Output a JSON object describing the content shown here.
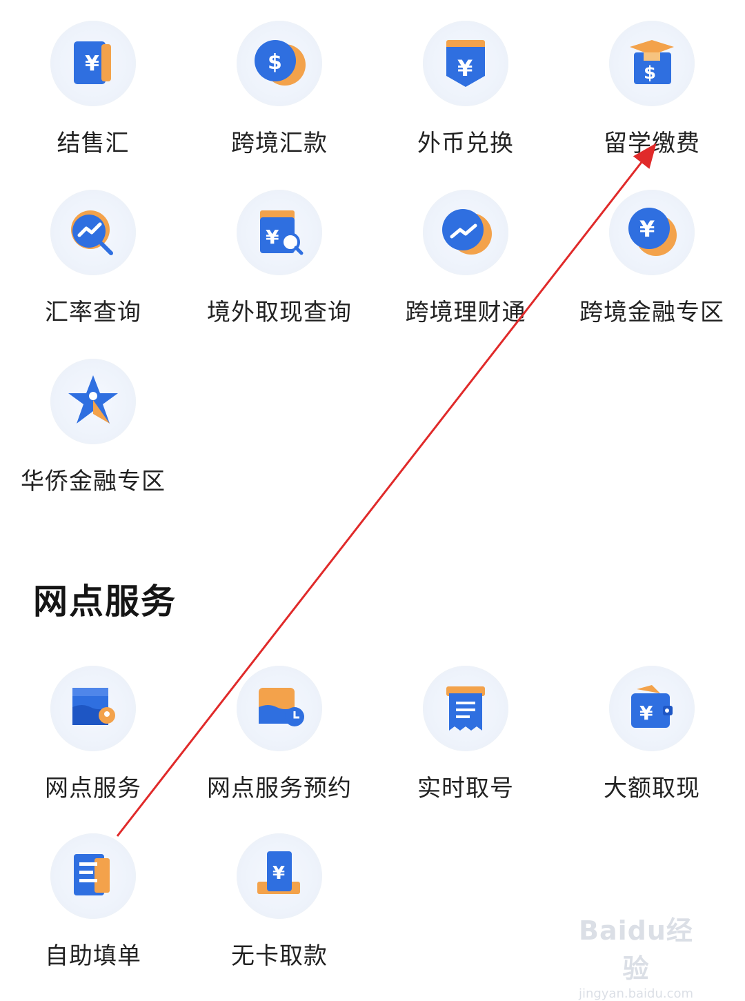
{
  "cross_border": {
    "items": [
      {
        "label": "结售汇",
        "icon": "currency-book-icon"
      },
      {
        "label": "跨境汇款",
        "icon": "dollar-coin-icon"
      },
      {
        "label": "外币兑换",
        "icon": "yuan-shield-icon"
      },
      {
        "label": "留学缴费",
        "icon": "graduation-cap-icon"
      },
      {
        "label": "汇率查询",
        "icon": "rate-search-icon"
      },
      {
        "label": "境外取现查询",
        "icon": "withdraw-search-icon"
      },
      {
        "label": "跨境理财通",
        "icon": "trend-coin-icon"
      },
      {
        "label": "跨境金融专区",
        "icon": "yuan-coin-icon"
      },
      {
        "label": "华侨金融专区",
        "icon": "star-person-icon"
      }
    ]
  },
  "branch_services": {
    "title": "网点服务",
    "items": [
      {
        "label": "网点服务",
        "icon": "branch-location-icon"
      },
      {
        "label": "网点服务预约",
        "icon": "branch-clock-icon"
      },
      {
        "label": "实时取号",
        "icon": "queue-ticket-icon"
      },
      {
        "label": "大额取现",
        "icon": "cash-wallet-icon"
      },
      {
        "label": "自助填单",
        "icon": "form-fill-icon"
      },
      {
        "label": "无卡取款",
        "icon": "cardless-withdraw-icon"
      }
    ]
  },
  "watermark": {
    "logo": "Baidu经验",
    "url": "jingyan.baidu.com"
  },
  "colors": {
    "primary_blue": "#2f6fe0",
    "accent_orange": "#f3a24b",
    "arrow_red": "#e02a2a"
  }
}
